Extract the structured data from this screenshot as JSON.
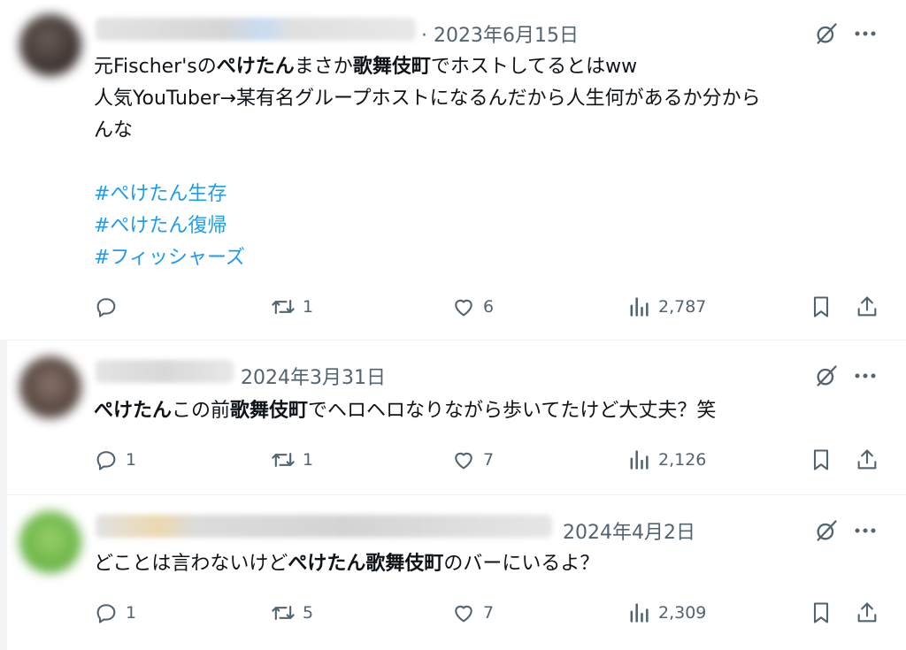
{
  "tweets": [
    {
      "date": "· 2023年6月15日",
      "lines": [
        [
          {
            "t": "元Fischer's"
          },
          {
            "t": "の"
          },
          {
            "t": "ぺけたん",
            "b": true
          },
          {
            "t": "まさか"
          },
          {
            "t": "歌舞伎町",
            "b": true
          },
          {
            "t": "でホストしてるとはww"
          }
        ],
        [
          {
            "t": "人気YouTuber→某有名グループホストになるんだから人生何があるか分から"
          }
        ],
        [
          {
            "t": "んな"
          }
        ]
      ],
      "hashtags": [
        "#ぺけたん生存",
        "#ぺけたん復帰",
        "#フィッシャーズ"
      ],
      "replies": "",
      "retweets": "1",
      "likes": "6",
      "views": "2,787"
    },
    {
      "date": "2024年3月31日",
      "lines": [
        [
          {
            "t": "ぺけたん",
            "b": true
          },
          {
            "t": "この前"
          },
          {
            "t": "歌舞伎町",
            "b": true
          },
          {
            "t": "でヘロヘロなりながら歩いてたけど大丈夫？笑"
          }
        ]
      ],
      "hashtags": [],
      "replies": "1",
      "retweets": "1",
      "likes": "7",
      "views": "2,126"
    },
    {
      "date": "2024年4月2日",
      "lines": [
        [
          {
            "t": "どことは言わないけど"
          },
          {
            "t": "ぺけたん",
            "b": true
          },
          {
            "t": "歌舞伎町",
            "b": true
          },
          {
            "t": "のバーにいるよ？"
          }
        ]
      ],
      "hashtags": [],
      "replies": "1",
      "retweets": "5",
      "likes": "7",
      "views": "2,309"
    }
  ],
  "icons": {
    "grok": "grok-icon",
    "more": "more-icon",
    "reply": "reply-icon",
    "retweet": "retweet-icon",
    "like": "heart-icon",
    "views": "views-icon",
    "bookmark": "bookmark-icon",
    "share": "share-icon"
  },
  "colors": {
    "text": "#0f1419",
    "muted": "#536471",
    "hashtag": "#1d9bf0",
    "divider": "#eff3f4"
  }
}
